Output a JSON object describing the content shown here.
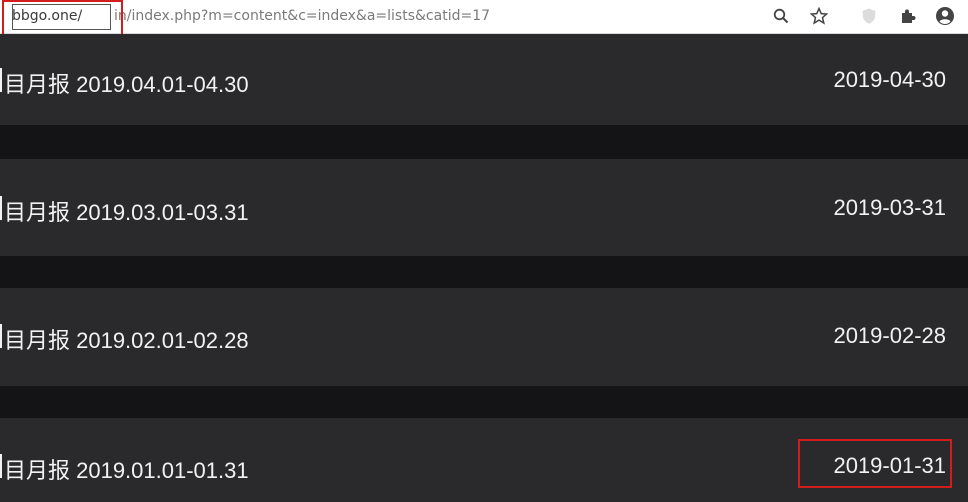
{
  "browser": {
    "url_domain": "bbgo.one/",
    "url_path": "in/index.php?m=content&c=index&a=lists&catid=17",
    "icons": [
      "search-icon",
      "star-icon",
      "extension-shield-icon",
      "puzzle-icon",
      "account-icon"
    ]
  },
  "list": {
    "items": [
      {
        "title": "目月报 2019.04.01-04.30",
        "date": "2019-04-30"
      },
      {
        "title": "目月报 2019.03.01-03.31",
        "date": "2019-03-31"
      },
      {
        "title": "目月报 2019.02.01-02.28",
        "date": "2019-02-28"
      },
      {
        "title": "目月报 2019.01.01-01.31",
        "date": "2019-01-31"
      }
    ]
  },
  "colors": {
    "row_bg": "#2a2a2d",
    "gap_bg": "#141416",
    "highlight": "#d21d1d",
    "text": "#f2f2f2"
  }
}
